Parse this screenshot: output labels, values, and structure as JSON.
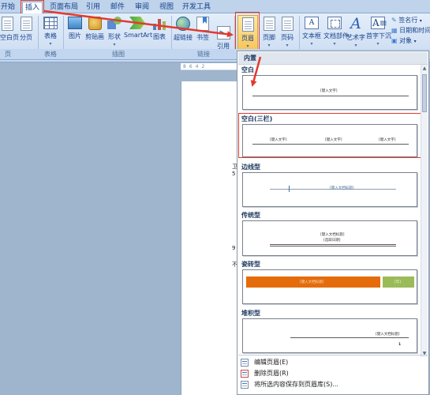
{
  "tabs": [
    "开始",
    "插入",
    "页面布局",
    "引用",
    "邮件",
    "审阅",
    "视图",
    "开发工具"
  ],
  "ribbon": {
    "pages": [
      "空白页",
      "分页"
    ],
    "table": "表格",
    "illustrations": [
      "图片",
      "剪贴画",
      "形状",
      "SmartArt",
      "图表"
    ],
    "links": [
      "超链接",
      "书签",
      "交叉引用"
    ],
    "crossref_visible": "引用",
    "header_footer": [
      "页眉",
      "页脚",
      "页码"
    ],
    "text": [
      "文本框",
      "文档部件",
      "艺术字",
      "首字下沉"
    ],
    "text_small": [
      "签名行",
      "日期和时间",
      "对象"
    ]
  },
  "group_labels": [
    "页",
    "表格",
    "插图",
    "链接"
  ],
  "gallery": {
    "header": "内置",
    "items": [
      {
        "title": "空白",
        "placeholders": [
          "[键入文字]"
        ]
      },
      {
        "title": "空白(三栏)",
        "placeholders": [
          "[键入文字]",
          "[键入文字]",
          "[键入文字]"
        ]
      },
      {
        "title": "边线型",
        "placeholders": [
          "[键入文档标题]"
        ]
      },
      {
        "title": "传统型",
        "placeholders": [
          "[键入文档标题]",
          "[选取日期]"
        ]
      },
      {
        "title": "瓷砖型",
        "placeholders": [
          "[键入文档标题]",
          "[年]"
        ]
      },
      {
        "title": "堆积型",
        "placeholders": [
          "[键入文档标题]",
          "1"
        ]
      }
    ],
    "menu": [
      "编辑页眉(E)",
      "删除页眉(R)",
      "将所选内容保存到页眉库(S)..."
    ]
  },
  "colors": {
    "annotation": "#e23a2e",
    "tile_orange": "#e46c0a",
    "tile_green": "#9bbb59"
  }
}
